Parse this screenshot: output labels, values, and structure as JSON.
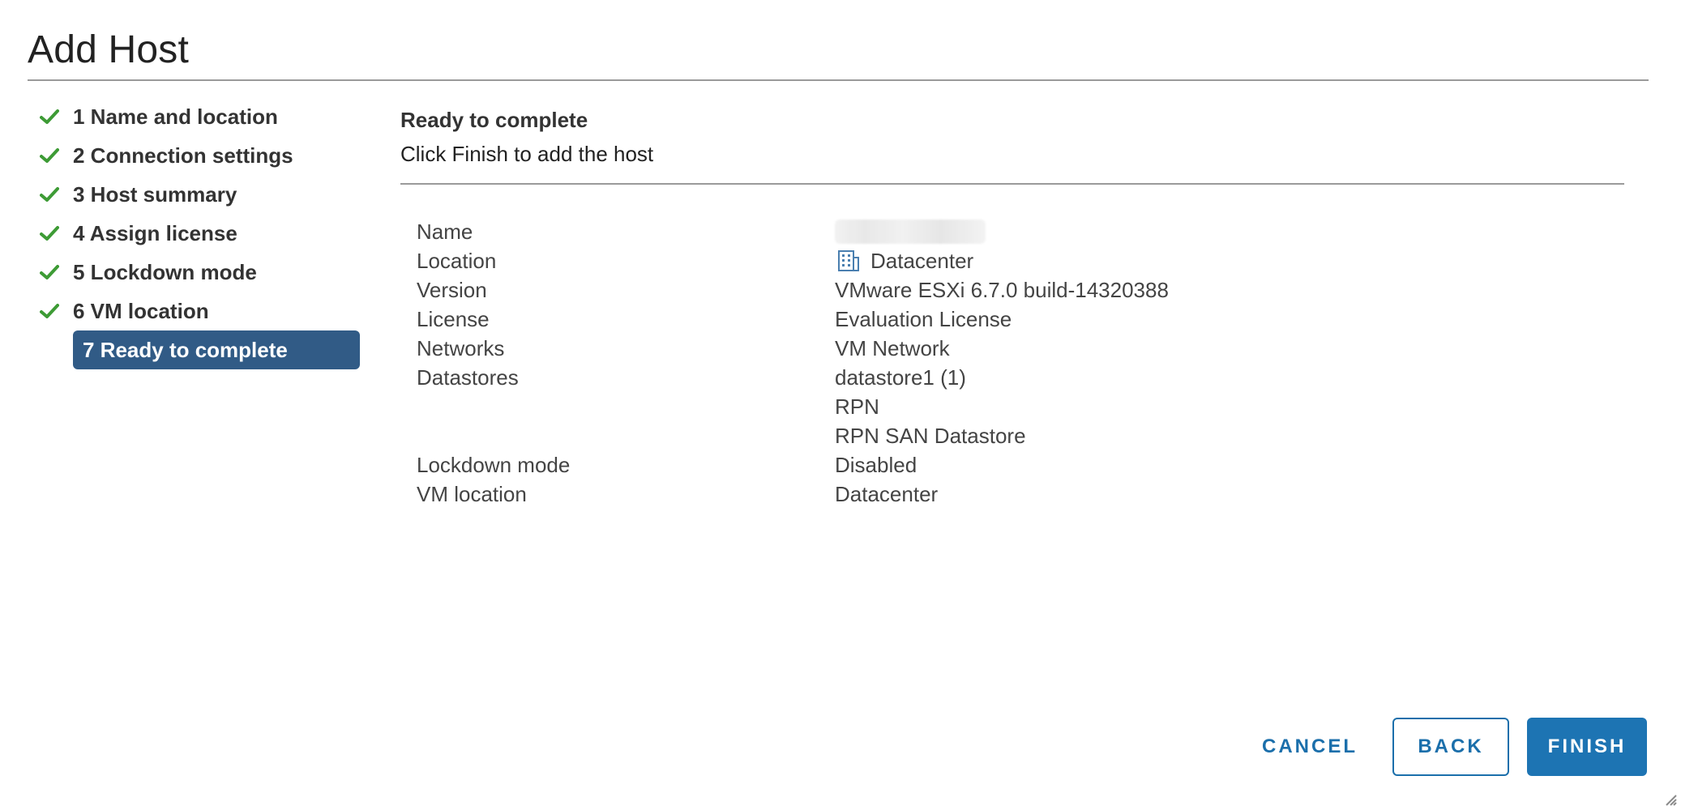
{
  "dialog": {
    "title": "Add Host"
  },
  "steps": [
    {
      "label": "1 Name and location",
      "completed": true
    },
    {
      "label": "2 Connection settings",
      "completed": true
    },
    {
      "label": "3 Host summary",
      "completed": true
    },
    {
      "label": "4 Assign license",
      "completed": true
    },
    {
      "label": "5 Lockdown mode",
      "completed": true
    },
    {
      "label": "6 VM location",
      "completed": true
    },
    {
      "label": "7 Ready to complete",
      "completed": false,
      "active": true
    }
  ],
  "content": {
    "heading": "Ready to complete",
    "subtitle": "Click Finish to add the host",
    "details": {
      "name_label": "Name",
      "location_label": "Location",
      "location_value": "Datacenter",
      "version_label": "Version",
      "version_value": "VMware ESXi 6.7.0 build-14320388",
      "license_label": "License",
      "license_value": "Evaluation License",
      "networks_label": "Networks",
      "networks_value": "VM Network",
      "datastores_label": "Datastores",
      "datastores_values": [
        "datastore1 (1)",
        "RPN",
        "RPN SAN Datastore"
      ],
      "lockdown_label": "Lockdown mode",
      "lockdown_value": "Disabled",
      "vm_location_label": "VM location",
      "vm_location_value": "Datacenter"
    }
  },
  "footer": {
    "cancel_label": "CANCEL",
    "back_label": "BACK",
    "finish_label": "FINISH"
  },
  "icons": {
    "step_complete": "check-icon",
    "location": "building-icon",
    "resize": "resize-grip-icon"
  },
  "colors": {
    "active_step_bg": "#315b86",
    "check_green": "#3d9b35",
    "primary_button": "#1d74b3",
    "link_blue": "#1b6fab"
  }
}
